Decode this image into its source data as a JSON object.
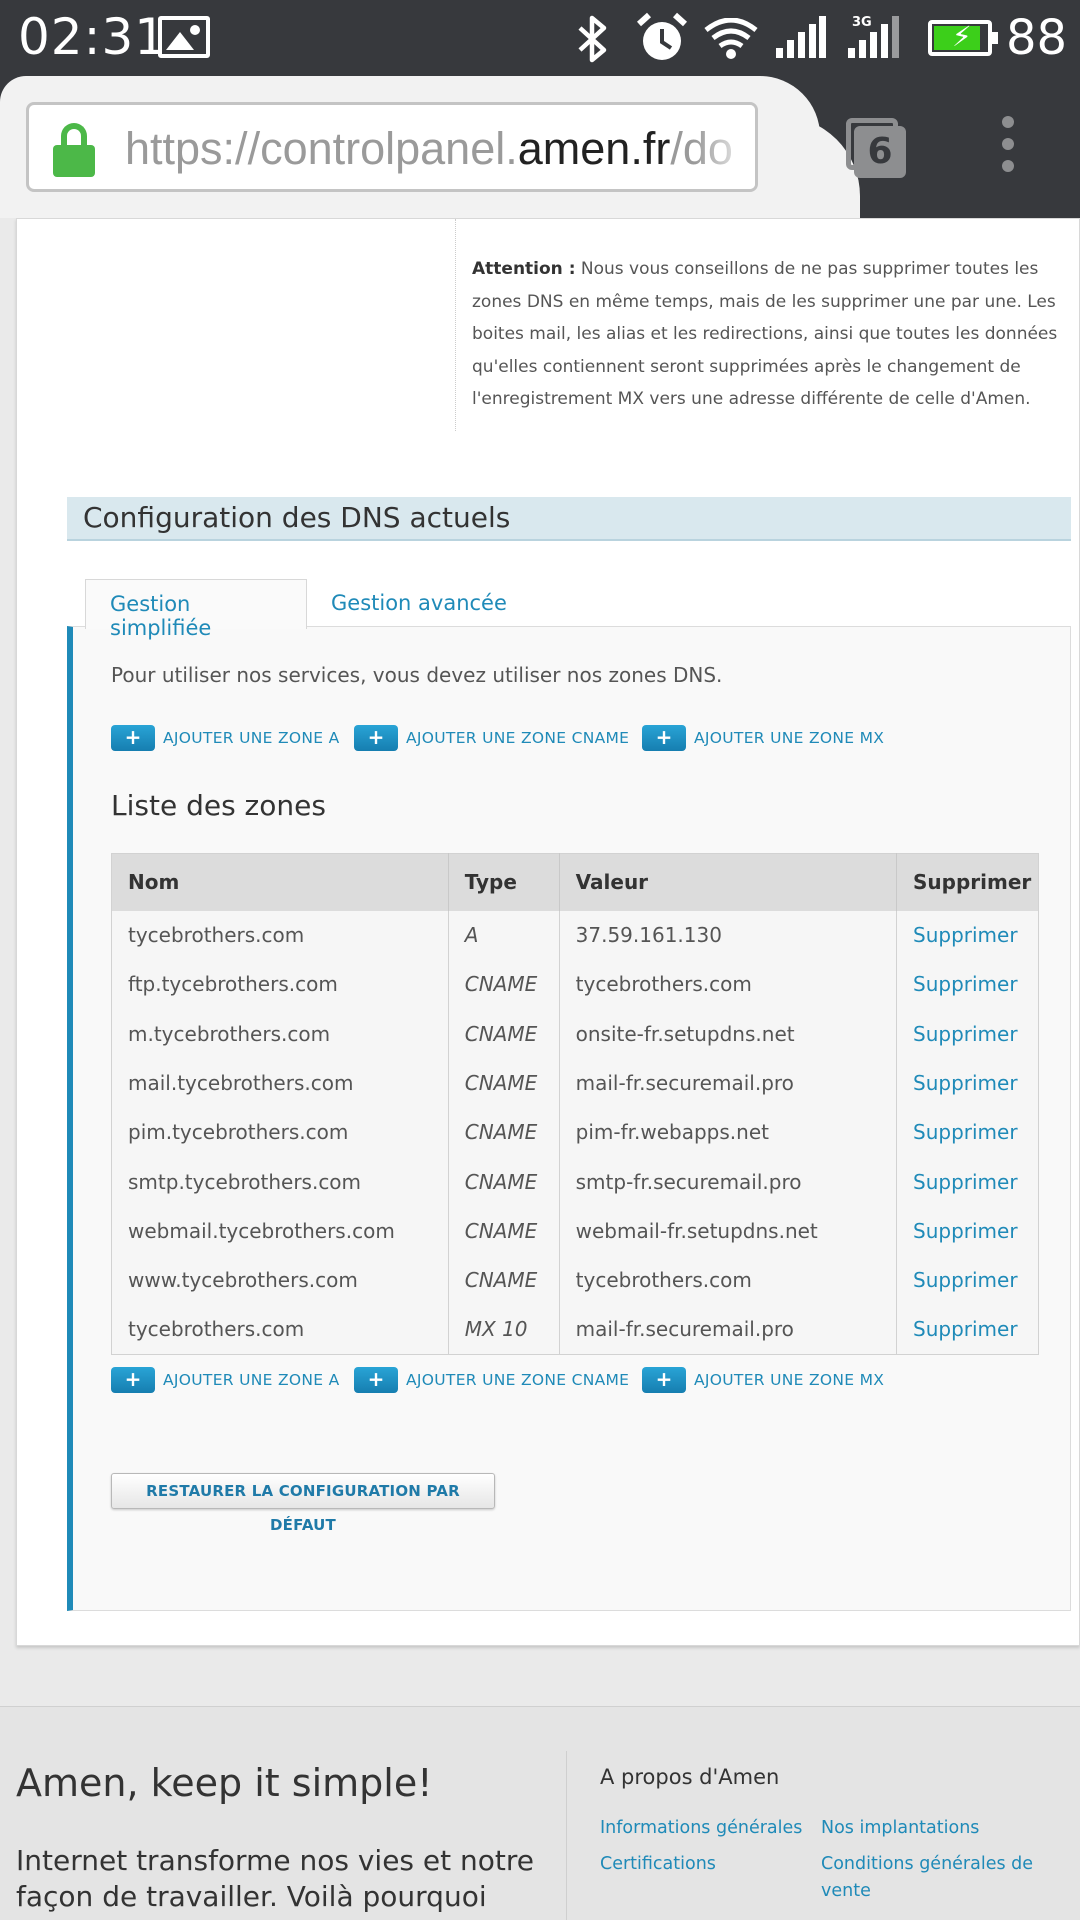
{
  "status_bar": {
    "time": "02:31",
    "battery_percent": "88",
    "battery_level": 0.88,
    "network_label": "3G",
    "icons": [
      "image-icon",
      "bluetooth-icon",
      "alarm-icon",
      "wifi-icon",
      "signal-icon",
      "signal-3g-icon",
      "battery-charging-icon"
    ]
  },
  "browser": {
    "url_prefix": "https://controlpanel.",
    "url_host": "amen.fr",
    "url_suffix": "/do",
    "tab_count": "6"
  },
  "attention": {
    "label": "Attention :",
    "text": "Nous vous conseillons de ne pas supprimer toutes les zones DNS en même temps, mais de les supprimer une par une. Les boites mail, les alias et les redirections, ainsi que toutes les données qu'elles contiennent seront supprimées après le changement de l'enregistrement MX vers une adresse différente de celle d'Amen."
  },
  "section_title": "Configuration des DNS actuels",
  "tabs": [
    {
      "label": "Gestion simplifiée",
      "active": true
    },
    {
      "label": "Gestion avancée",
      "active": false
    }
  ],
  "panel": {
    "intro": "Pour utiliser nos services, vous devez utiliser nos zones DNS.",
    "add_buttons": [
      {
        "plus": "+",
        "label": "AJOUTER UNE ZONE A"
      },
      {
        "plus": "+",
        "label": "AJOUTER UNE ZONE CNAME"
      },
      {
        "plus": "+",
        "label": "AJOUTER UNE ZONE MX"
      }
    ],
    "zones_title": "Liste des zones",
    "columns": [
      "Nom",
      "Type",
      "Valeur",
      "Supprimer"
    ],
    "rows": [
      {
        "nom": "tycebrothers.com",
        "type": "A",
        "valeur": "37.59.161.130",
        "action": "Supprimer"
      },
      {
        "nom": "ftp.tycebrothers.com",
        "type": "CNAME",
        "valeur": "tycebrothers.com",
        "action": "Supprimer"
      },
      {
        "nom": "m.tycebrothers.com",
        "type": "CNAME",
        "valeur": "onsite-fr.setupdns.net",
        "action": "Supprimer"
      },
      {
        "nom": "mail.tycebrothers.com",
        "type": "CNAME",
        "valeur": "mail-fr.securemail.pro",
        "action": "Supprimer"
      },
      {
        "nom": "pim.tycebrothers.com",
        "type": "CNAME",
        "valeur": "pim-fr.webapps.net",
        "action": "Supprimer"
      },
      {
        "nom": "smtp.tycebrothers.com",
        "type": "CNAME",
        "valeur": "smtp-fr.securemail.pro",
        "action": "Supprimer"
      },
      {
        "nom": "webmail.tycebrothers.com",
        "type": "CNAME",
        "valeur": "webmail-fr.setupdns.net",
        "action": "Supprimer"
      },
      {
        "nom": "www.tycebrothers.com",
        "type": "CNAME",
        "valeur": "tycebrothers.com",
        "action": "Supprimer"
      },
      {
        "nom": "tycebrothers.com",
        "type": "MX 10",
        "valeur": "mail-fr.securemail.pro",
        "action": "Supprimer"
      }
    ],
    "restore_label": "RESTAURER LA CONFIGURATION PAR DÉFAUT"
  },
  "footer": {
    "slogan": "Amen, keep it simple!",
    "intro": "Internet transforme nos vies et notre façon de travailler. Voilà pourquoi",
    "about_title": "A propos d'Amen",
    "links": [
      "Informations générales",
      "Nos implantations",
      "Certifications",
      "Conditions générales de vente"
    ]
  },
  "colors": {
    "accent": "#1f8ab8",
    "status_bar": "#37393d",
    "battery_fill": "#3ccf1a",
    "lock_green": "#4cb848",
    "section_header": "#d9e8ee"
  }
}
